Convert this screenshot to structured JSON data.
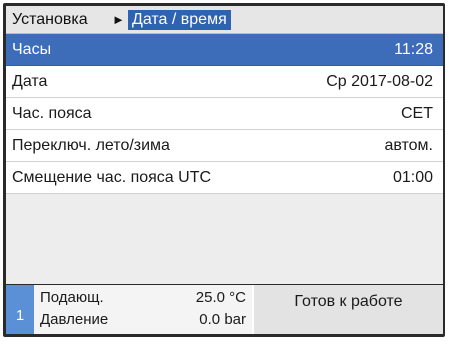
{
  "breadcrumb": {
    "root": "Установка",
    "separator_glyph": "►",
    "current": "Дата / время"
  },
  "settings": [
    {
      "label": "Часы",
      "value": "11:28",
      "selected": true
    },
    {
      "label": "Дата",
      "value": "Ср 2017-08-02",
      "selected": false
    },
    {
      "label": "Час. пояса",
      "value": "CET",
      "selected": false
    },
    {
      "label": "Переключ. лето/зима",
      "value": "автом.",
      "selected": false
    },
    {
      "label": "Смещение час. пояса UTC",
      "value": "01:00",
      "selected": false
    }
  ],
  "status": {
    "slot": "1",
    "readings": [
      {
        "label": "Подающ.",
        "value": "25.0 °C"
      },
      {
        "label": "Давление",
        "value": "0.0 bar"
      }
    ],
    "state": "Готов к работе"
  },
  "colors": {
    "selection": "#3d6cb8",
    "breadcrumb_current": "#2f62b0",
    "slot_badge": "#5b8fd6"
  },
  "icons": {
    "breadcrumb_separator": "triangle-right-icon"
  }
}
